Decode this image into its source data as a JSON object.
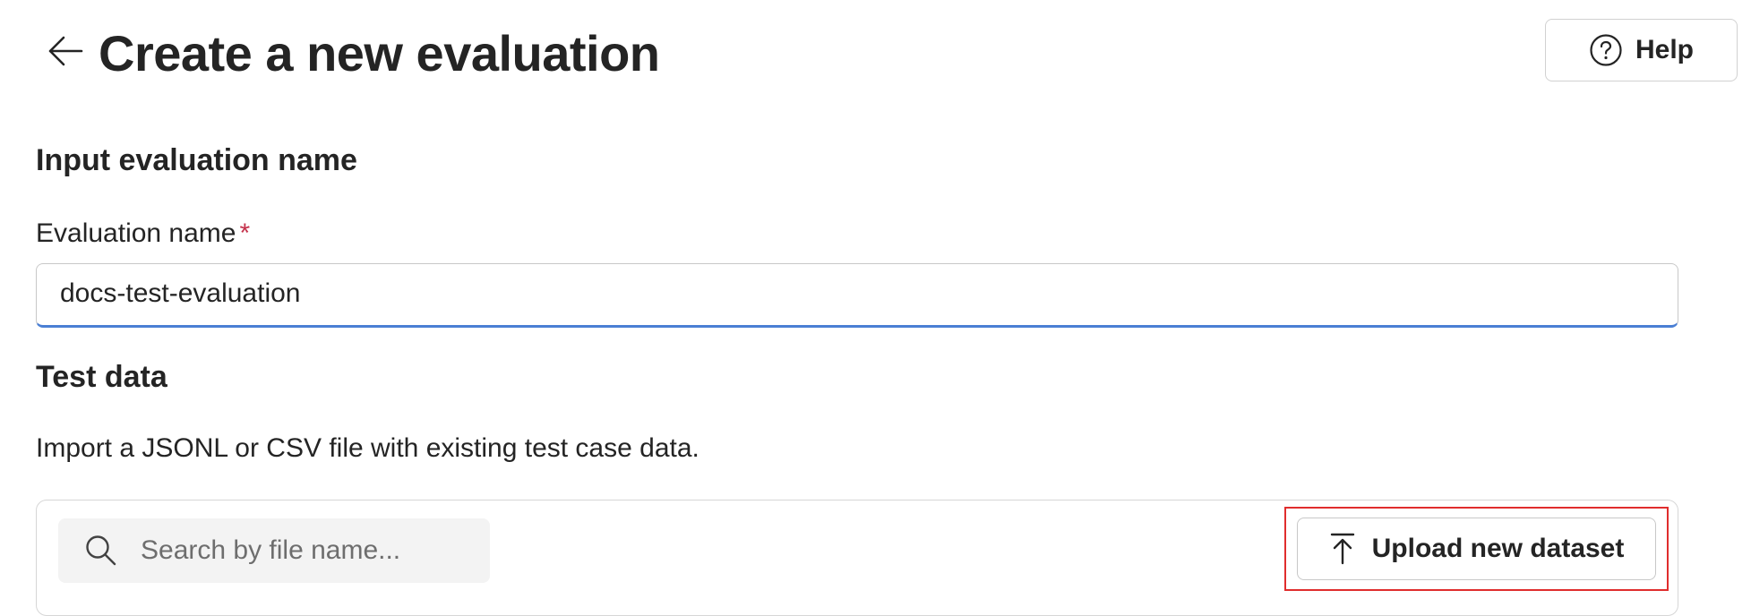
{
  "header": {
    "title": "Create a new evaluation",
    "back_icon": "arrow-left-icon",
    "help_label": "Help",
    "help_icon": "question-circle-icon"
  },
  "name_section": {
    "heading": "Input evaluation name",
    "field_label": "Evaluation name",
    "required_marker": "*",
    "value": "docs-test-evaluation"
  },
  "test_data_section": {
    "heading": "Test data",
    "description": "Import a JSONL or CSV file with existing test case data.",
    "search_placeholder": "Search by file name...",
    "search_icon": "search-icon",
    "upload_label": "Upload new dataset",
    "upload_icon": "arrow-upload-icon"
  },
  "colors": {
    "text": "#242424",
    "input_focus_border": "#4a7fd4",
    "required": "#c4314b",
    "highlight_box": "#e02d2d",
    "search_bg": "#f3f3f3"
  }
}
